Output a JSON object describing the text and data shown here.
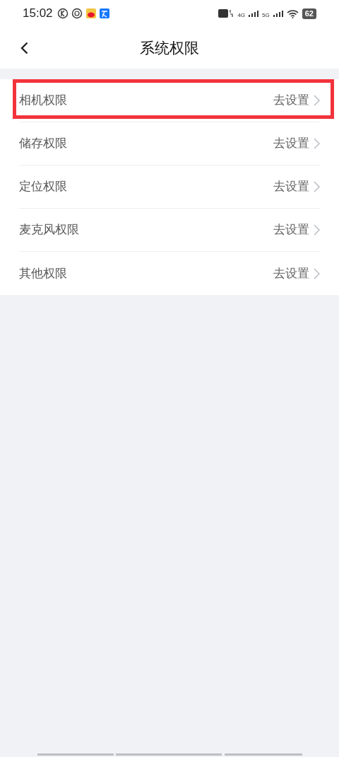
{
  "status_bar": {
    "time": "15:02",
    "network_1": "4G",
    "network_2": "5G",
    "battery": "62"
  },
  "header": {
    "title": "系统权限"
  },
  "rows": [
    {
      "label": "相机权限",
      "action": "去设置",
      "highlighted": true
    },
    {
      "label": "储存权限",
      "action": "去设置",
      "highlighted": false
    },
    {
      "label": "定位权限",
      "action": "去设置",
      "highlighted": false
    },
    {
      "label": "麦克风权限",
      "action": "去设置",
      "highlighted": false
    },
    {
      "label": "其他权限",
      "action": "去设置",
      "highlighted": false
    }
  ]
}
